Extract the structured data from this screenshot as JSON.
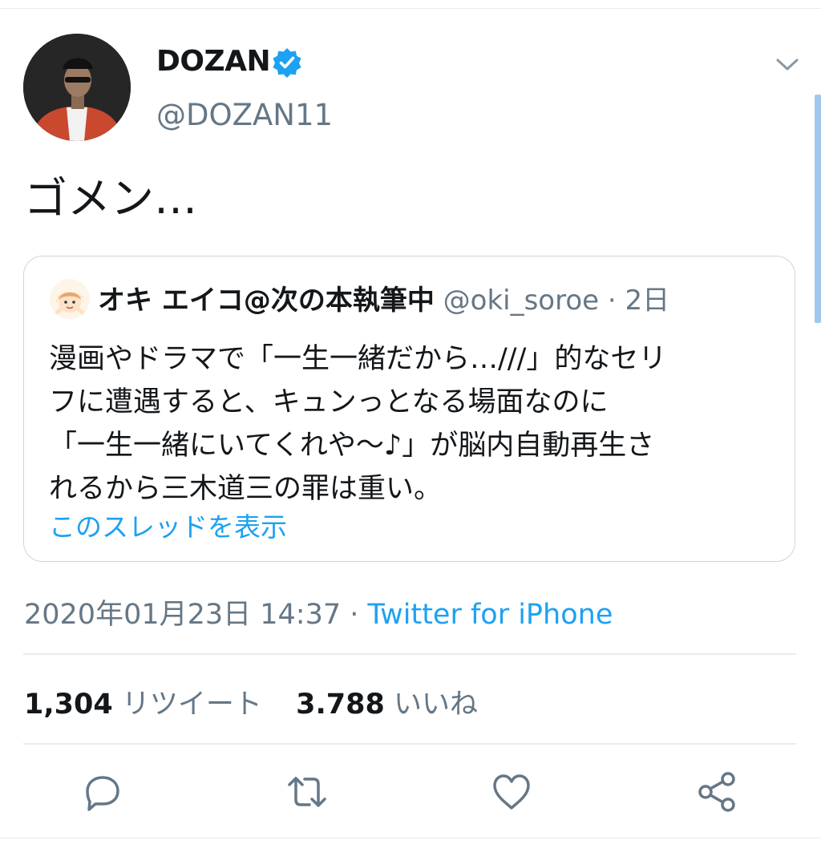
{
  "tweet": {
    "display_name": "DOZAN",
    "handle": "@DOZAN11",
    "text": "ゴメン…",
    "date": "2020年01月23日 14:37",
    "separator": " · ",
    "source": "Twitter for iPhone"
  },
  "quote": {
    "name": "オキ エイコ@次の本執筆中",
    "handle": "@oki_soroe",
    "time": " · 2日",
    "lines": [
      "漫画やドラマで「一生一緒だから…///」的なセリ",
      "フに遭遇すると、キュンっとなる場面なのに",
      "「一生一緒にいてくれや〜♪」が脳内自動再生さ",
      "れるから三木道三の罪は重い。"
    ],
    "thread_link": "このスレッドを表示"
  },
  "stats": {
    "retweets_count": "1,304",
    "retweets_label": "リツイート",
    "likes_count": "3.788",
    "likes_label": "いいね"
  },
  "icons": {
    "verified": "verified-badge-icon",
    "menu": "chevron-down-icon",
    "reply": "reply-icon",
    "retweet": "retweet-icon",
    "like": "heart-icon",
    "share": "share-icon"
  },
  "colors": {
    "accent": "#1da1f2",
    "muted": "#657786",
    "border": "#ccd6dd"
  }
}
